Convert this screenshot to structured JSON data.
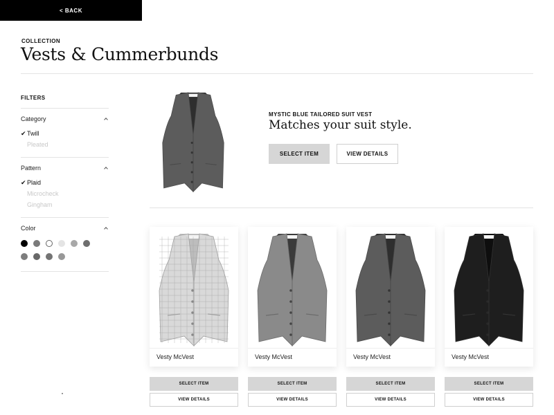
{
  "nav": {
    "back_label": "< BACK"
  },
  "header": {
    "eyebrow": "COLLECTION",
    "title": "Vests & Cummerbunds"
  },
  "filters": {
    "title": "FILTERS",
    "category": {
      "label": "Category",
      "options": [
        {
          "label": "Twill",
          "checked": true
        },
        {
          "label": "Pleated",
          "checked": false
        }
      ]
    },
    "pattern": {
      "label": "Pattern",
      "options": [
        {
          "label": "Plaid",
          "checked": true
        },
        {
          "label": "Microcheck",
          "checked": false
        },
        {
          "label": "Gingham",
          "checked": false
        }
      ]
    },
    "color": {
      "label": "Color",
      "swatches": [
        "#000000",
        "#7a7a7a",
        "#ffffff",
        "#e4e4e4",
        "#a8a8a8",
        "#6e6e6e",
        "#7d7d7d",
        "#686868",
        "#747474",
        "#989898"
      ]
    }
  },
  "feature": {
    "eyebrow": "MYSTIC BLUE TAILORED SUIT VEST",
    "title": "Matches your suit style.",
    "select_label": "SELECT ITEM",
    "details_label": "VIEW DETAILS"
  },
  "products": [
    {
      "name": "Vesty McVest",
      "tone": "light",
      "select_label": "SELECT ITEM",
      "details_label": "VIEW DETAILS"
    },
    {
      "name": "Vesty McVest",
      "tone": "mid",
      "select_label": "SELECT ITEM",
      "details_label": "VIEW DETAILS"
    },
    {
      "name": "Vesty McVest",
      "tone": "dark",
      "select_label": "SELECT ITEM",
      "details_label": "VIEW DETAILS"
    },
    {
      "name": "Vesty McVest",
      "tone": "black",
      "select_label": "SELECT ITEM",
      "details_label": "VIEW DETAILS"
    }
  ],
  "icons": {
    "check": "check-icon",
    "chevron": "chevron-up-icon",
    "vest": "vest-image"
  }
}
